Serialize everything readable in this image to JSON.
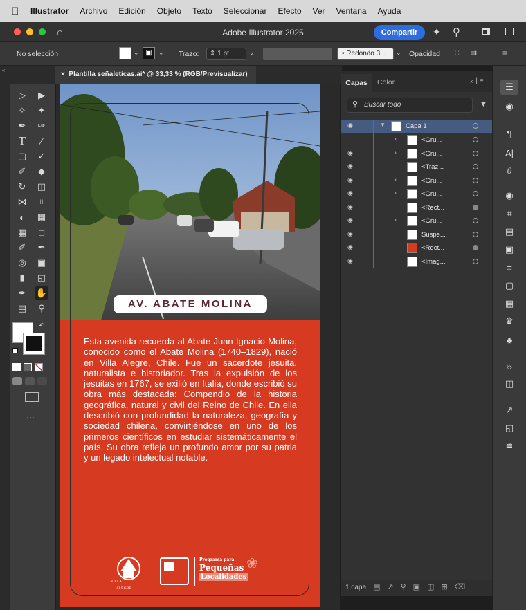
{
  "menubar": {
    "items": [
      "Illustrator",
      "Archivo",
      "Edición",
      "Objeto",
      "Texto",
      "Seleccionar",
      "Efecto",
      "Ver",
      "Ventana",
      "Ayuda"
    ]
  },
  "window": {
    "title": "Adobe Illustrator 2025",
    "share_label": "Compartir"
  },
  "control": {
    "selection": "No selección",
    "stroke_label": "Trazo:",
    "stroke_value": "1 pt",
    "brush": "Redondo 3...",
    "opacity_label": "Opacidad"
  },
  "document": {
    "tab_title": "Plantilla señaleticas.ai* @ 33,33 % (RGB/Previsualizar)"
  },
  "artboard": {
    "street_name": "AV. ABATE MOLINA",
    "description": "Esta avenida recuerda al Abate Juan Ignacio Molina, conocido como el Abate Molina (1740–1829), nació en Villa Alegre, Chile. Fue un sacerdote jesuita, naturalista e historiador. Tras la expulsión de los jesuitas en 1767, se exilió en Italia, donde escribió su obra más destacada: Compendio de la historia geográfica, natural y civil del Reino de Chile. En ella describió con profundidad la naturaleza, geografía y sociedad chilena, convirtiéndose en uno de los primeros científicos en estudiar sistemáticamente el país. Su obra refleja un profundo amor por su patria y un legado intelectual notable.",
    "program_small": "Programa para",
    "program_big1": "Pequeñas",
    "program_big2": "Localidades",
    "colors": {
      "red": "#d63b21",
      "badge_text": "#5a2630"
    }
  },
  "layers_panel": {
    "tabs": [
      "Capas",
      "Color"
    ],
    "search_placeholder": "Buscar todo",
    "layer_name": "Capa 1",
    "rows": [
      {
        "label": "<Gru...",
        "eye": false,
        "expand": true,
        "filled": false
      },
      {
        "label": "<Gru...",
        "eye": true,
        "expand": true,
        "filled": false
      },
      {
        "label": "<Traz...",
        "eye": true,
        "expand": false,
        "filled": false
      },
      {
        "label": "<Gru...",
        "eye": true,
        "expand": true,
        "filled": false
      },
      {
        "label": "<Gru...",
        "eye": true,
        "expand": true,
        "filled": false
      },
      {
        "label": "<Rect...",
        "eye": true,
        "expand": false,
        "filled": true
      },
      {
        "label": "<Gru...",
        "eye": true,
        "expand": true,
        "filled": false
      },
      {
        "label": "Suspe...",
        "eye": true,
        "expand": false,
        "filled": false
      },
      {
        "label": "<Rect...",
        "eye": true,
        "expand": false,
        "filled": true
      },
      {
        "label": "<Imag...",
        "eye": true,
        "expand": false,
        "filled": false
      }
    ],
    "footer": "1 capa"
  }
}
